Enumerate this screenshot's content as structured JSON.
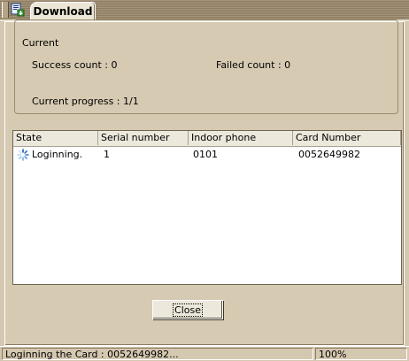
{
  "window": {
    "tab_title": "Download"
  },
  "current_group": {
    "title": "Current",
    "success_count": "Success count : 0",
    "failed_count": "Failed count : 0",
    "current_progress": "Current progress :  1/1"
  },
  "table": {
    "columns": [
      "State",
      "Serial number",
      "Indoor phone",
      "Card Number"
    ],
    "rows": [
      {
        "state": "Loginning.",
        "serial": "1",
        "indoor_phone": "0101",
        "card_number": "0052649982"
      }
    ]
  },
  "buttons": {
    "close_label": "Close"
  },
  "status_bar": {
    "message": "Loginning the Card :  0052649982...",
    "zoom": "100%"
  },
  "icons": {
    "app": "download-app-icon",
    "state": "spinner-icon"
  },
  "colors": {
    "background": "#d4c8b0",
    "accent": "#3a7bd5"
  }
}
